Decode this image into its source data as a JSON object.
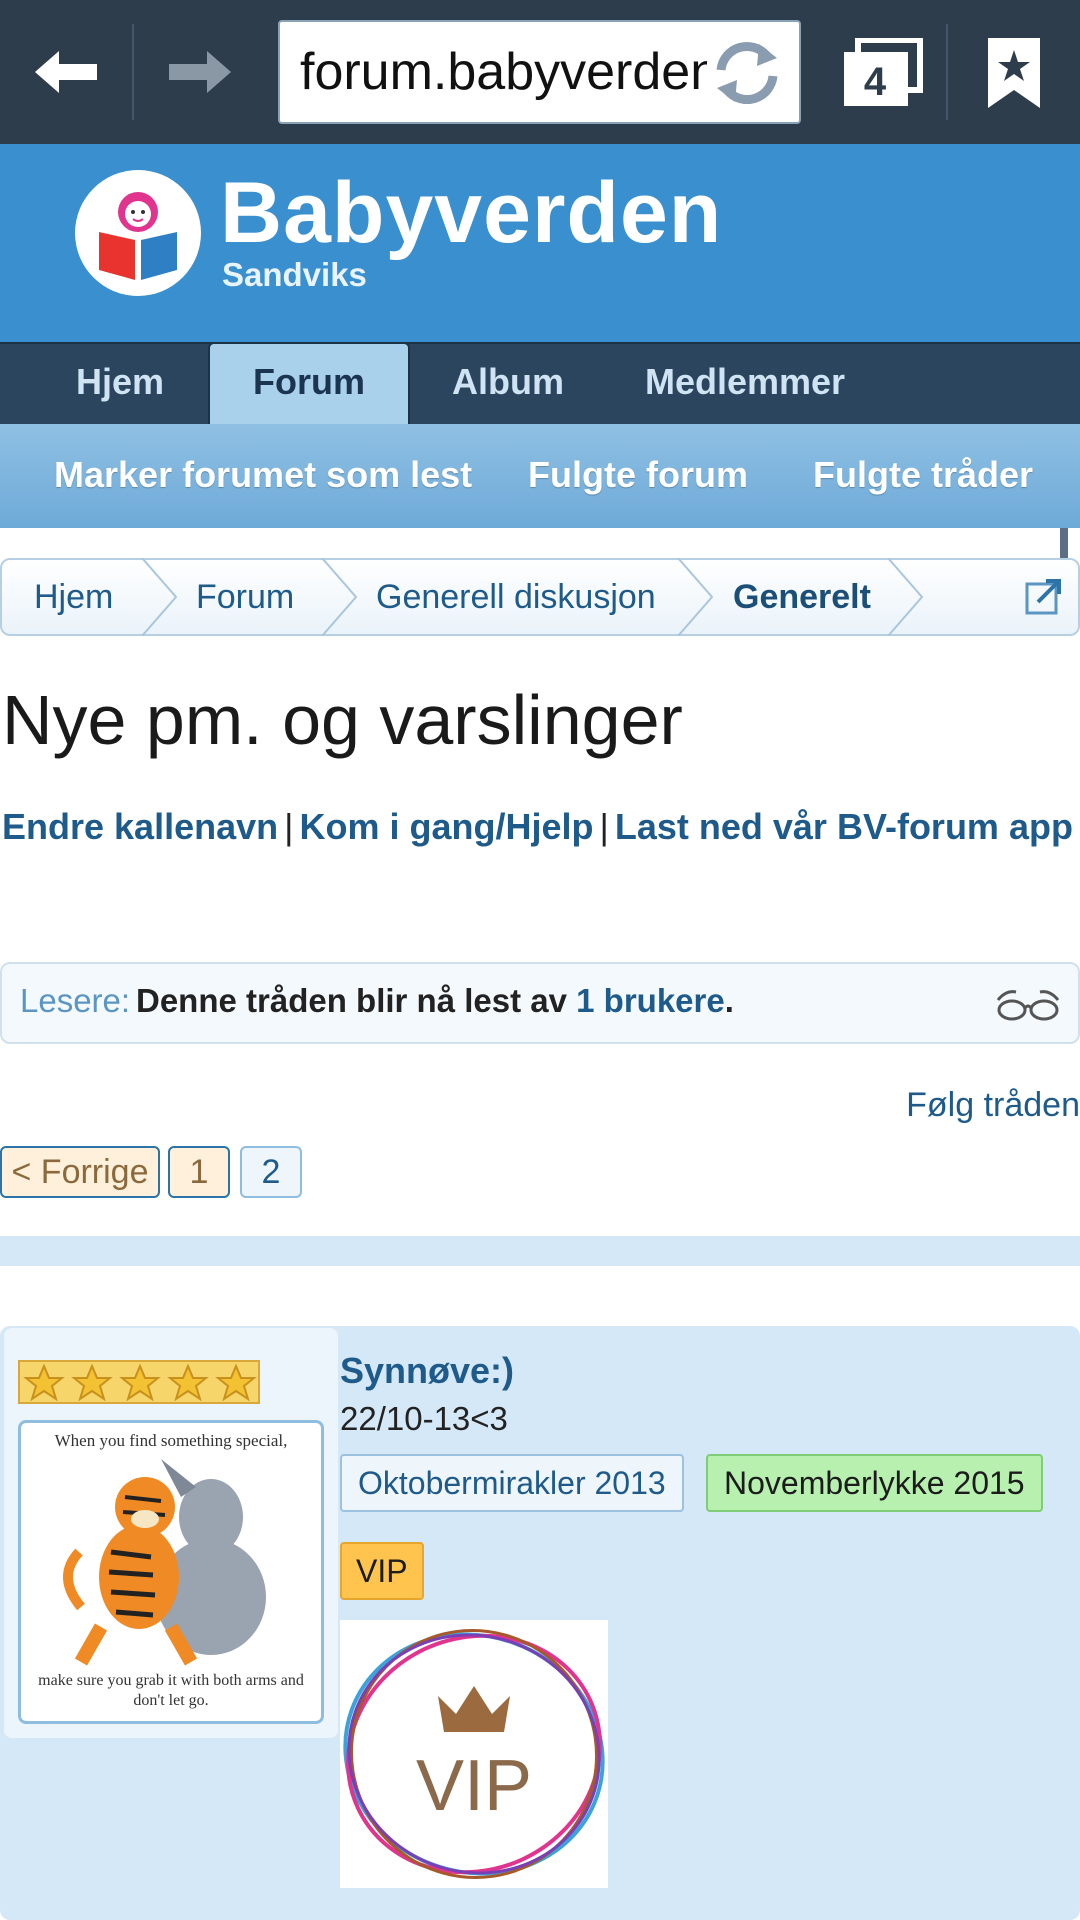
{
  "browser": {
    "url": "forum.babyverden.no",
    "tab_count": "4"
  },
  "site": {
    "title": "Babyverden",
    "subtitle": "Sandviks",
    "colors": {
      "header": "#3a8fcf",
      "nav": "#2b455e",
      "link": "#1e5b8a"
    }
  },
  "main_nav": {
    "items": [
      {
        "label": "Hjem"
      },
      {
        "label": "Forum",
        "active": true
      },
      {
        "label": "Album"
      },
      {
        "label": "Medlemmer"
      }
    ]
  },
  "sub_nav": {
    "items": [
      {
        "label": "Marker forumet som lest"
      },
      {
        "label": "Fulgte forum"
      },
      {
        "label": "Fulgte tråder"
      }
    ]
  },
  "breadcrumb": {
    "items": [
      {
        "label": "Hjem"
      },
      {
        "label": "Forum"
      },
      {
        "label": "Generell diskusjon"
      },
      {
        "label": "Generelt"
      }
    ]
  },
  "thread": {
    "title": "Nye pm. og varslinger"
  },
  "help_links": {
    "items": [
      {
        "label": "Endre kallenavn"
      },
      {
        "label": "Kom i gang/Hjelp"
      },
      {
        "label": "Last ned vår BV-forum app"
      }
    ],
    "separator": "|"
  },
  "readers": {
    "label": "Lesere:",
    "text_before": "Denne tråden blir nå lest av ",
    "count": "1 brukere",
    "text_after": "."
  },
  "follow_label": "Følg tråden",
  "pagination": {
    "prev_label": "< Forrige",
    "pages": [
      "1",
      "2"
    ]
  },
  "post": {
    "username": "Synnøve:)",
    "user_title": "22/10-13<3",
    "rating_stars": 5,
    "avatar_caption_top": "When you find something special,",
    "avatar_caption_bottom": "make sure you grab it with both arms and don't let go.",
    "tags": [
      "Oktobermirakler 2013",
      "Novemberlykke 2015",
      "VIP"
    ],
    "vip_logo_text": "VIP"
  }
}
